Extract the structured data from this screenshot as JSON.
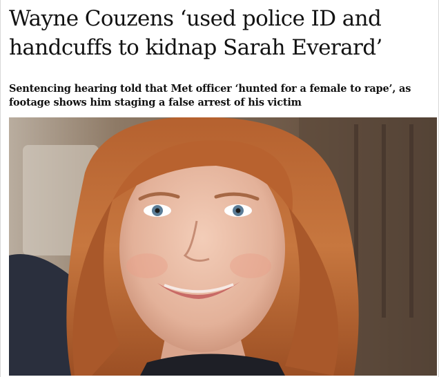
{
  "article": {
    "headline": "Wayne Couzens ‘used police ID and handcuffs to kidnap Sarah Everard’",
    "standfirst": "Sentencing hearing told that Met officer ‘hunted for a female to rape’, as footage shows him staging a false arrest of his victim"
  },
  "image": {
    "subject": "portrait photo of a smiling young woman with long auburn hair"
  }
}
